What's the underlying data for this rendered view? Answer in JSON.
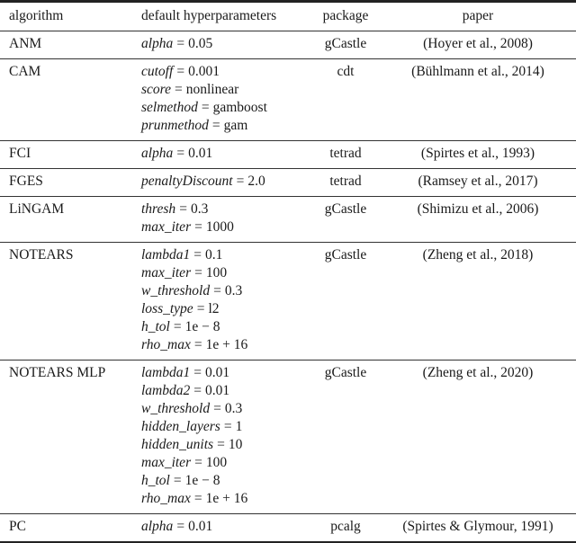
{
  "table": {
    "headers": {
      "algorithm": "algorithm",
      "hyperparameters": "default hyperparameters",
      "package": "package",
      "paper": "paper"
    },
    "rows": [
      {
        "algorithm": "ANM",
        "hyperparameters": [
          {
            "name": "alpha",
            "value": "0.05"
          }
        ],
        "package": "gCastle",
        "paper": "(Hoyer et al., 2008)"
      },
      {
        "algorithm": "CAM",
        "hyperparameters": [
          {
            "name": "cutoff",
            "value": "0.001"
          },
          {
            "name": "score",
            "value": "nonlinear"
          },
          {
            "name": "selmethod",
            "value": "gamboost"
          },
          {
            "name": "prunmethod",
            "value": "gam"
          }
        ],
        "package": "cdt",
        "paper": "(Bühlmann et al., 2014)"
      },
      {
        "algorithm": "FCI",
        "hyperparameters": [
          {
            "name": "alpha",
            "value": "0.01"
          }
        ],
        "package": "tetrad",
        "paper": "(Spirtes et al., 1993)"
      },
      {
        "algorithm": "FGES",
        "hyperparameters": [
          {
            "name": "penaltyDiscount",
            "value": "2.0"
          }
        ],
        "package": "tetrad",
        "paper": "(Ramsey et al., 2017)"
      },
      {
        "algorithm": "LiNGAM",
        "hyperparameters": [
          {
            "name": "thresh",
            "value": "0.3"
          },
          {
            "name": "max_iter",
            "value": "1000"
          }
        ],
        "package": "gCastle",
        "paper": "(Shimizu et al., 2006)"
      },
      {
        "algorithm": "NOTEARS",
        "hyperparameters": [
          {
            "name": "lambda1",
            "value": "0.1"
          },
          {
            "name": "max_iter",
            "value": "100"
          },
          {
            "name": "w_threshold",
            "value": "0.3"
          },
          {
            "name": "loss_type",
            "value": "l2"
          },
          {
            "name": "h_tol",
            "value": "1e − 8"
          },
          {
            "name": "rho_max",
            "value": "1e + 16"
          }
        ],
        "package": "gCastle",
        "paper": "(Zheng et al., 2018)"
      },
      {
        "algorithm": "NOTEARS MLP",
        "hyperparameters": [
          {
            "name": "lambda1",
            "value": "0.01"
          },
          {
            "name": "lambda2",
            "value": "0.01"
          },
          {
            "name": "w_threshold",
            "value": "0.3"
          },
          {
            "name": "hidden_layers",
            "value": "1"
          },
          {
            "name": "hidden_units",
            "value": "10"
          },
          {
            "name": "max_iter",
            "value": "100"
          },
          {
            "name": "h_tol",
            "value": "1e − 8"
          },
          {
            "name": "rho_max",
            "value": "1e + 16"
          }
        ],
        "package": "gCastle",
        "paper": "(Zheng et al., 2020)"
      },
      {
        "algorithm": "PC",
        "hyperparameters": [
          {
            "name": "alpha",
            "value": "0.01"
          }
        ],
        "package": "pcalg",
        "paper": "(Spirtes & Glymour, 1991)"
      }
    ]
  },
  "chart_data": {
    "type": "table",
    "columns": [
      "algorithm",
      "default hyperparameters",
      "package",
      "paper"
    ],
    "rows": [
      [
        "ANM",
        "alpha = 0.05",
        "gCastle",
        "(Hoyer et al., 2008)"
      ],
      [
        "CAM",
        "cutoff = 0.001; score = nonlinear; selmethod = gamboost; prunmethod = gam",
        "cdt",
        "(Bühlmann et al., 2014)"
      ],
      [
        "FCI",
        "alpha = 0.01",
        "tetrad",
        "(Spirtes et al., 1993)"
      ],
      [
        "FGES",
        "penaltyDiscount = 2.0",
        "tetrad",
        "(Ramsey et al., 2017)"
      ],
      [
        "LiNGAM",
        "thresh = 0.3; max_iter = 1000",
        "gCastle",
        "(Shimizu et al., 2006)"
      ],
      [
        "NOTEARS",
        "lambda1 = 0.1; max_iter = 100; w_threshold = 0.3; loss_type = l2; h_tol = 1e − 8; rho_max = 1e + 16",
        "gCastle",
        "(Zheng et al., 2018)"
      ],
      [
        "NOTEARS MLP",
        "lambda1 = 0.01; lambda2 = 0.01; w_threshold = 0.3; hidden_layers = 1; hidden_units = 10; max_iter = 100; h_tol = 1e − 8; rho_max = 1e + 16",
        "gCastle",
        "(Zheng et al., 2020)"
      ],
      [
        "PC",
        "alpha = 0.01",
        "pcalg",
        "(Spirtes & Glymour, 1991)"
      ]
    ]
  }
}
